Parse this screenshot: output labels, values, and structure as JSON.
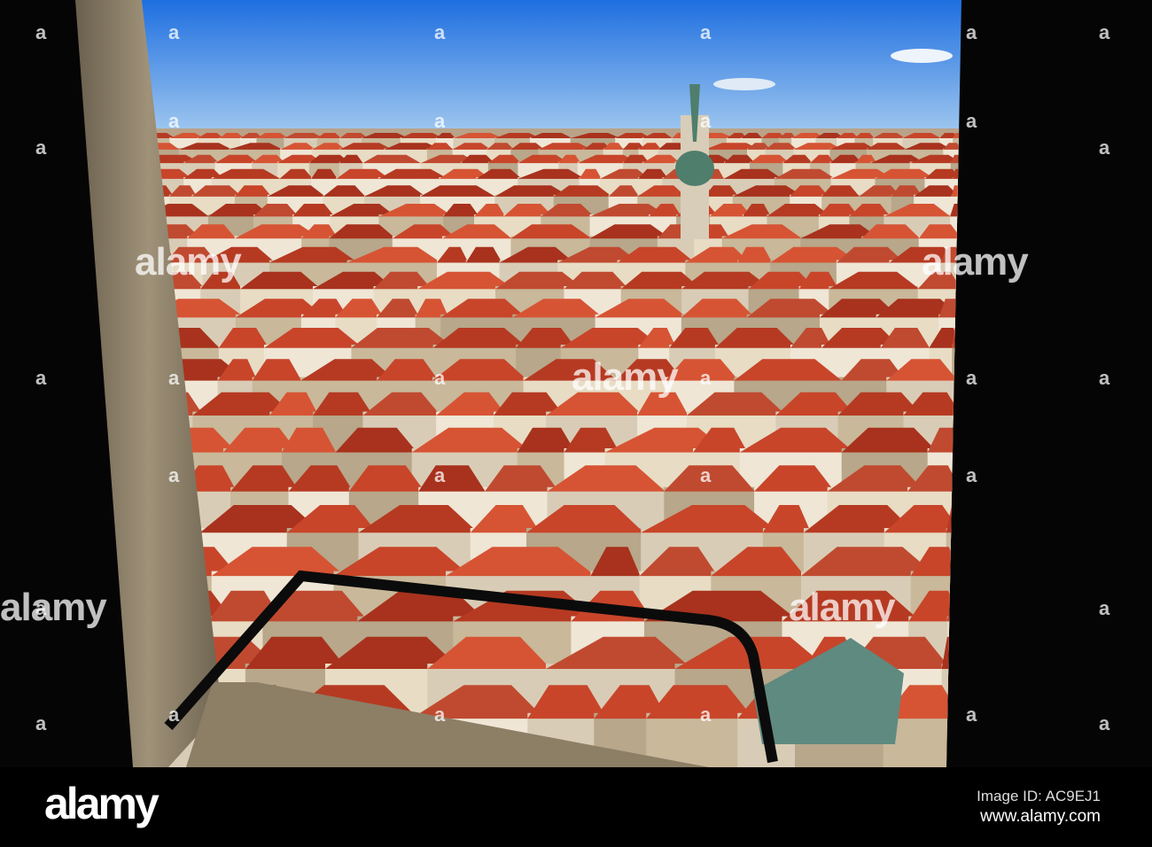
{
  "watermark": {
    "big": "alamy",
    "small": "a"
  },
  "footer": {
    "logo": "alamy",
    "image_id": "Image ID: AC9EJ1",
    "site": "www.alamy.com"
  },
  "colors": {
    "sky_top": "#1e6fe0",
    "sky_bottom": "#9cc6f0",
    "roof": "#c8452a",
    "frame": "#060505",
    "stone": "#8f8168"
  }
}
